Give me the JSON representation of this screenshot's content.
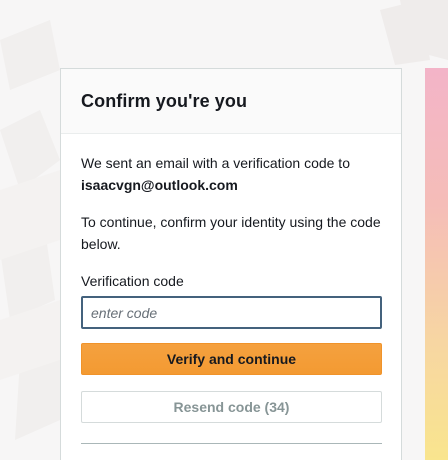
{
  "card": {
    "title": "Confirm you're you",
    "message_line1": "We sent an email with a verification code to",
    "email": "isaacvgn@outlook.com",
    "message_line2": "To continue, confirm your identity using the code below."
  },
  "form": {
    "code_label": "Verification code",
    "code_placeholder": "enter code",
    "code_value": "",
    "verify_label": "Verify and continue",
    "resend_label": "Resend code (34)"
  },
  "colors": {
    "primary_button": "#f49d37",
    "input_focus_border": "#44627d",
    "disabled_text": "#879596"
  }
}
